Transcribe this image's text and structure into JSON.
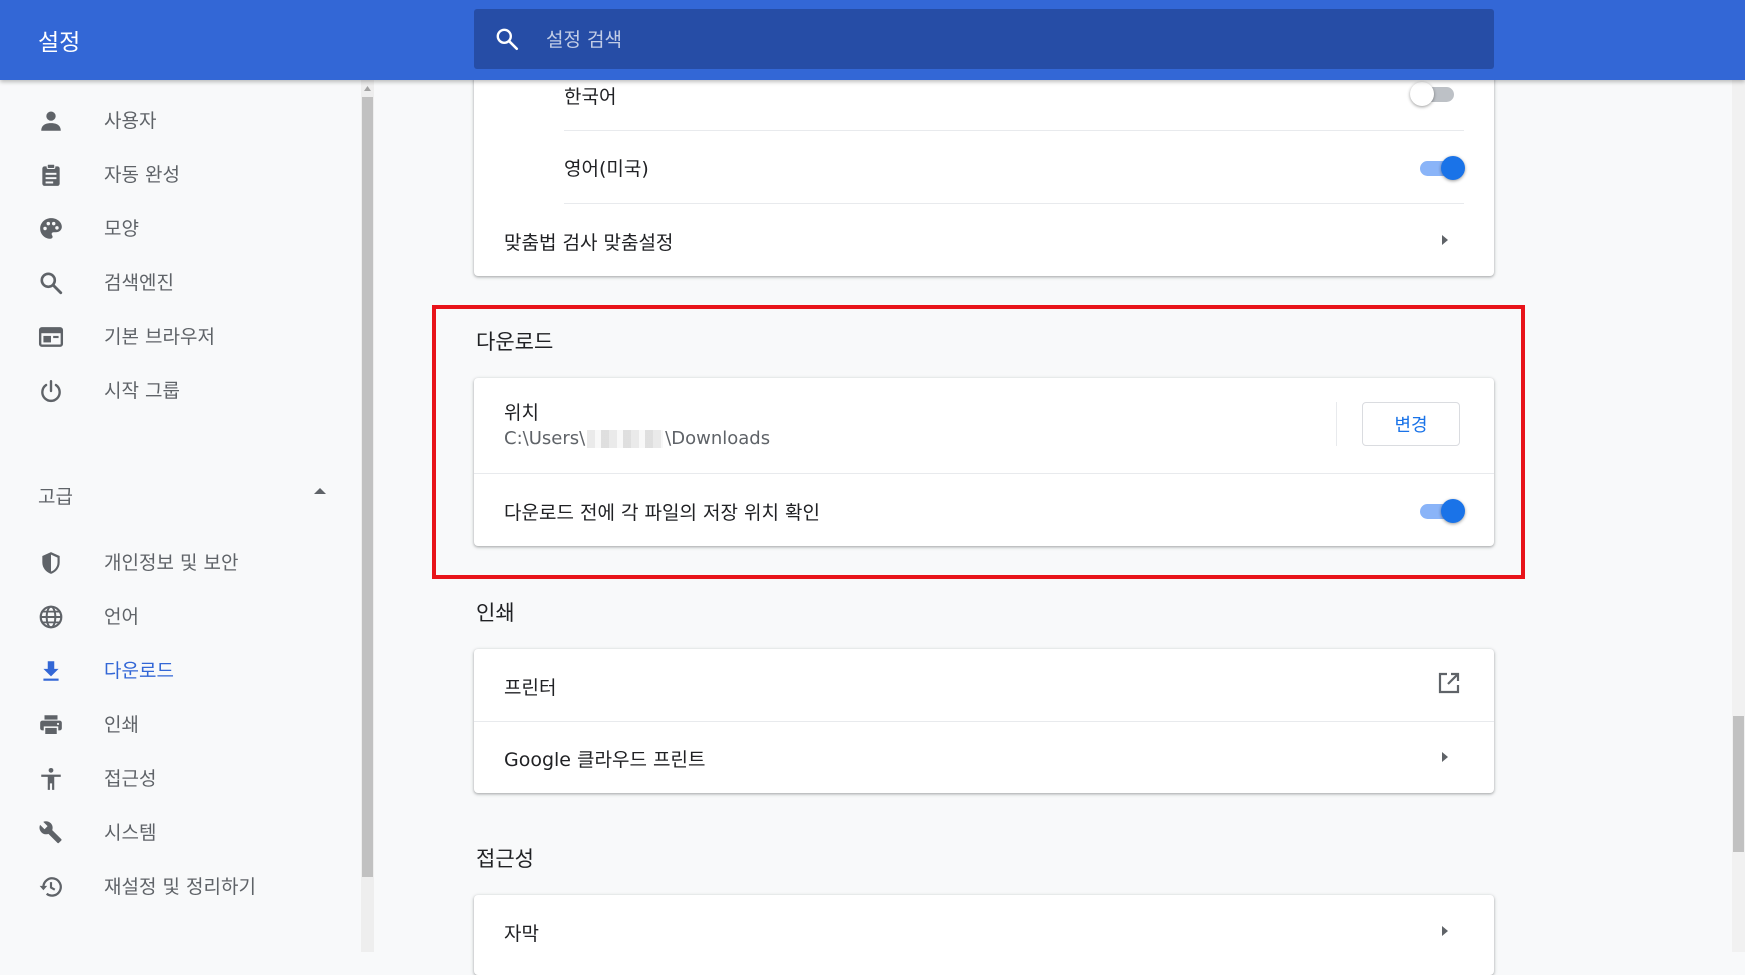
{
  "header": {
    "title": "설정",
    "search_placeholder": "설정 검색",
    "color": "#3367d6"
  },
  "sidebar": {
    "items": [
      {
        "label": "사용자",
        "icon": "person-icon"
      },
      {
        "label": "자동 완성",
        "icon": "clipboard-icon"
      },
      {
        "label": "모양",
        "icon": "palette-icon"
      },
      {
        "label": "검색엔진",
        "icon": "search-icon"
      },
      {
        "label": "기본 브라우저",
        "icon": "browser-window-icon"
      },
      {
        "label": "시작 그룹",
        "icon": "power-icon"
      }
    ],
    "advanced_label": "고급",
    "advanced_items": [
      {
        "label": "개인정보 및 보안",
        "icon": "shield-icon"
      },
      {
        "label": "언어",
        "icon": "globe-icon"
      },
      {
        "label": "다운로드",
        "icon": "download-icon",
        "active": true
      },
      {
        "label": "인쇄",
        "icon": "printer-icon"
      },
      {
        "label": "접근성",
        "icon": "accessibility-icon"
      },
      {
        "label": "시스템",
        "icon": "wrench-icon"
      },
      {
        "label": "재설정 및 정리하기",
        "icon": "history-icon"
      }
    ]
  },
  "languages_card": {
    "korean_label": "한국어",
    "korean_enabled": false,
    "english_label": "영어(미국)",
    "english_enabled": true,
    "spellcheck_custom_label": "맞춤법 검사 맞춤설정"
  },
  "downloads": {
    "title": "다운로드",
    "location_label": "위치",
    "location_prefix": "C:\\Users\\",
    "location_suffix": "\\Downloads",
    "change_button": "변경",
    "ask_where_label": "다운로드 전에 각 파일의 저장 위치 확인",
    "ask_where_enabled": true
  },
  "printing": {
    "title": "인쇄",
    "printers_label": "프린터",
    "cloud_print_label": "Google 클라우드 프린트"
  },
  "accessibility": {
    "title": "접근성",
    "captions_label": "자막"
  },
  "colors": {
    "accent": "#1a73e8",
    "highlight_border": "#e8131a"
  }
}
